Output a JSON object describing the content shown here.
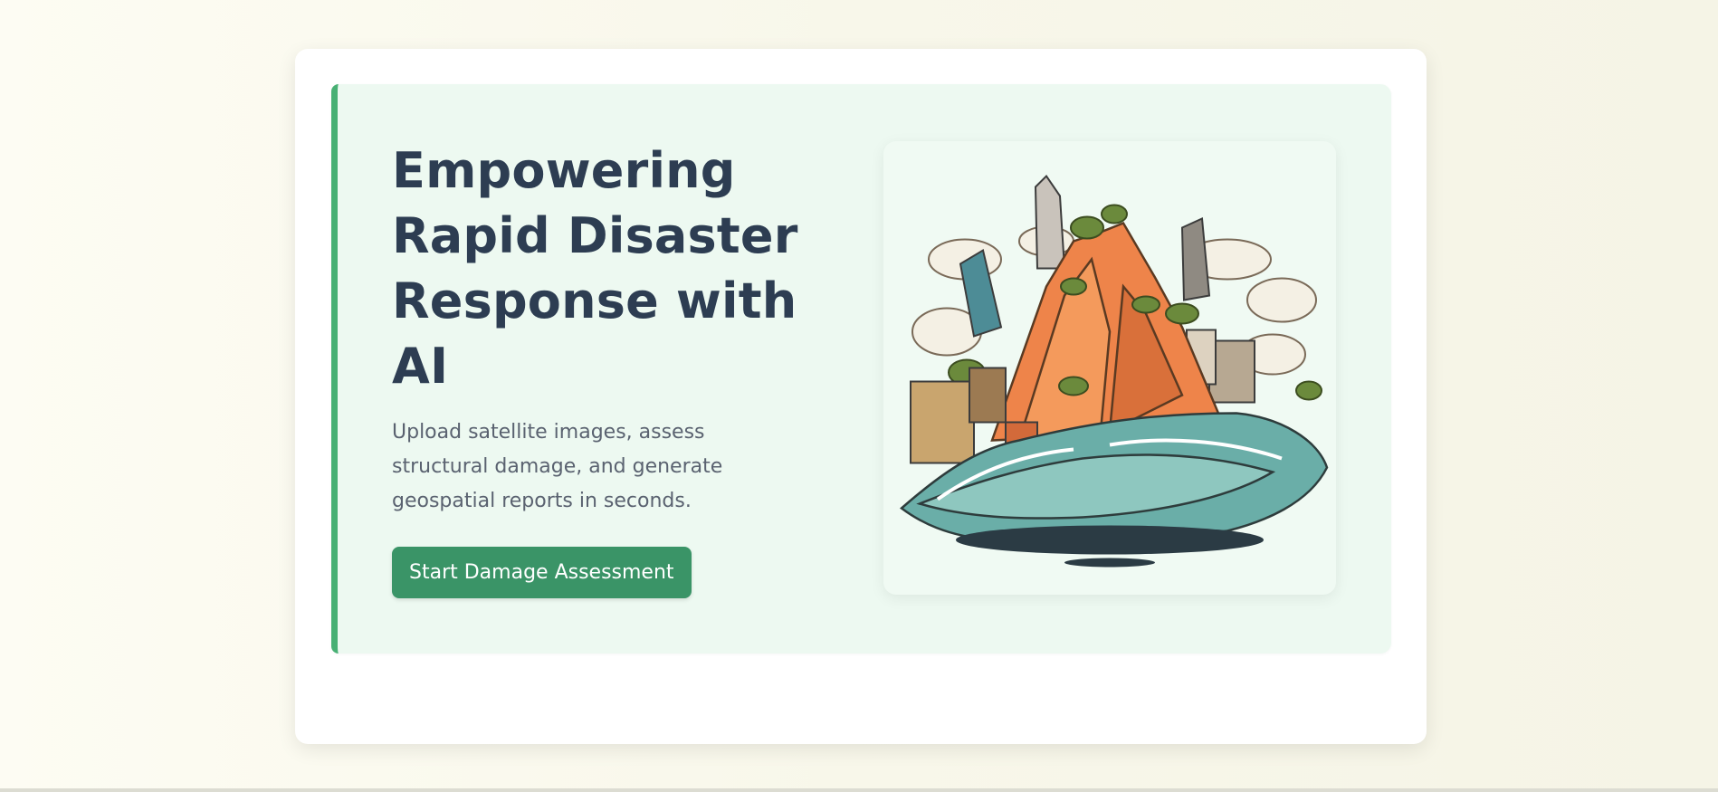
{
  "hero": {
    "title": "Empowering Rapid Disaster Response with AI",
    "subtitle": "Upload satellite images, assess structural damage, and generate geospatial reports in seconds.",
    "cta_label": "Start Damage Assessment",
    "illustration": "disaster-wave-city-illustration"
  },
  "colors": {
    "page_bg": "#fbfaf0",
    "hero_bg": "#edf9f1",
    "accent_border": "#48b074",
    "title": "#2d3d52",
    "subtitle": "#5a6270",
    "button": "#3a9467",
    "button_text": "#ffffff"
  }
}
